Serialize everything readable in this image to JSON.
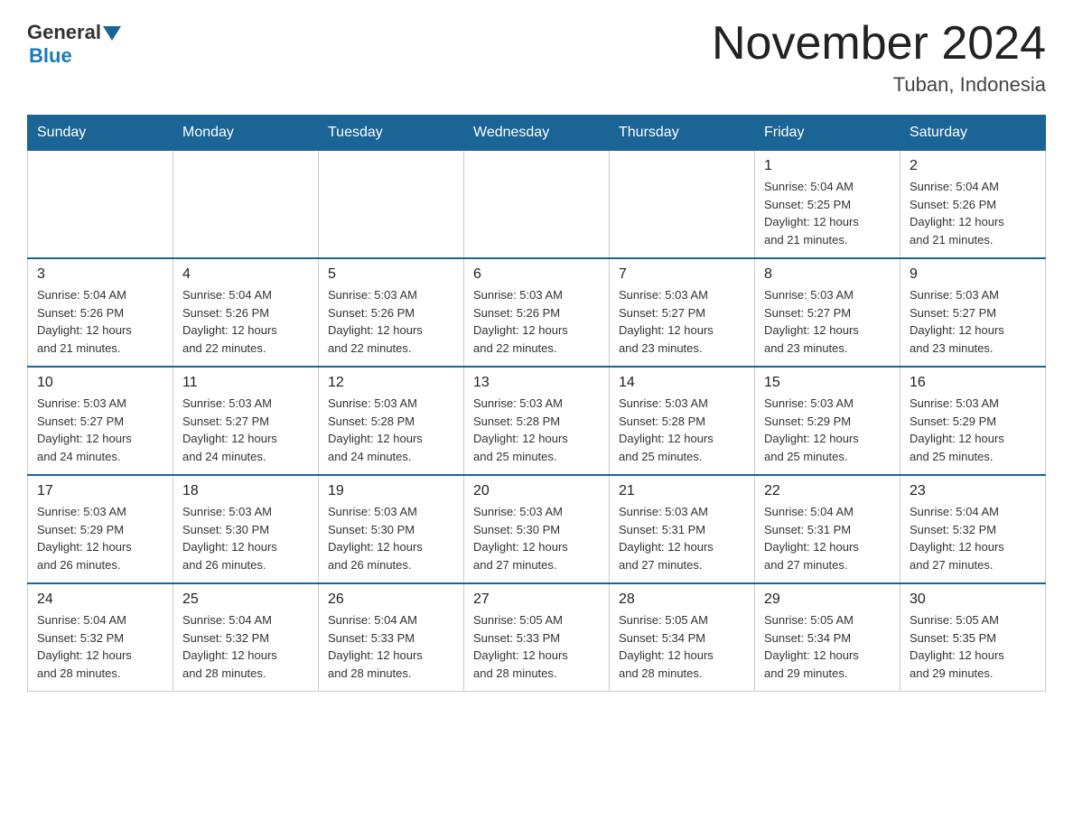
{
  "header": {
    "logo_text_general": "General",
    "logo_text_blue": "Blue",
    "month_title": "November 2024",
    "location": "Tuban, Indonesia"
  },
  "weekdays": [
    "Sunday",
    "Monday",
    "Tuesday",
    "Wednesday",
    "Thursday",
    "Friday",
    "Saturday"
  ],
  "weeks": [
    [
      {
        "day": "",
        "info": ""
      },
      {
        "day": "",
        "info": ""
      },
      {
        "day": "",
        "info": ""
      },
      {
        "day": "",
        "info": ""
      },
      {
        "day": "",
        "info": ""
      },
      {
        "day": "1",
        "info": "Sunrise: 5:04 AM\nSunset: 5:25 PM\nDaylight: 12 hours\nand 21 minutes."
      },
      {
        "day": "2",
        "info": "Sunrise: 5:04 AM\nSunset: 5:26 PM\nDaylight: 12 hours\nand 21 minutes."
      }
    ],
    [
      {
        "day": "3",
        "info": "Sunrise: 5:04 AM\nSunset: 5:26 PM\nDaylight: 12 hours\nand 21 minutes."
      },
      {
        "day": "4",
        "info": "Sunrise: 5:04 AM\nSunset: 5:26 PM\nDaylight: 12 hours\nand 22 minutes."
      },
      {
        "day": "5",
        "info": "Sunrise: 5:03 AM\nSunset: 5:26 PM\nDaylight: 12 hours\nand 22 minutes."
      },
      {
        "day": "6",
        "info": "Sunrise: 5:03 AM\nSunset: 5:26 PM\nDaylight: 12 hours\nand 22 minutes."
      },
      {
        "day": "7",
        "info": "Sunrise: 5:03 AM\nSunset: 5:27 PM\nDaylight: 12 hours\nand 23 minutes."
      },
      {
        "day": "8",
        "info": "Sunrise: 5:03 AM\nSunset: 5:27 PM\nDaylight: 12 hours\nand 23 minutes."
      },
      {
        "day": "9",
        "info": "Sunrise: 5:03 AM\nSunset: 5:27 PM\nDaylight: 12 hours\nand 23 minutes."
      }
    ],
    [
      {
        "day": "10",
        "info": "Sunrise: 5:03 AM\nSunset: 5:27 PM\nDaylight: 12 hours\nand 24 minutes."
      },
      {
        "day": "11",
        "info": "Sunrise: 5:03 AM\nSunset: 5:27 PM\nDaylight: 12 hours\nand 24 minutes."
      },
      {
        "day": "12",
        "info": "Sunrise: 5:03 AM\nSunset: 5:28 PM\nDaylight: 12 hours\nand 24 minutes."
      },
      {
        "day": "13",
        "info": "Sunrise: 5:03 AM\nSunset: 5:28 PM\nDaylight: 12 hours\nand 25 minutes."
      },
      {
        "day": "14",
        "info": "Sunrise: 5:03 AM\nSunset: 5:28 PM\nDaylight: 12 hours\nand 25 minutes."
      },
      {
        "day": "15",
        "info": "Sunrise: 5:03 AM\nSunset: 5:29 PM\nDaylight: 12 hours\nand 25 minutes."
      },
      {
        "day": "16",
        "info": "Sunrise: 5:03 AM\nSunset: 5:29 PM\nDaylight: 12 hours\nand 25 minutes."
      }
    ],
    [
      {
        "day": "17",
        "info": "Sunrise: 5:03 AM\nSunset: 5:29 PM\nDaylight: 12 hours\nand 26 minutes."
      },
      {
        "day": "18",
        "info": "Sunrise: 5:03 AM\nSunset: 5:30 PM\nDaylight: 12 hours\nand 26 minutes."
      },
      {
        "day": "19",
        "info": "Sunrise: 5:03 AM\nSunset: 5:30 PM\nDaylight: 12 hours\nand 26 minutes."
      },
      {
        "day": "20",
        "info": "Sunrise: 5:03 AM\nSunset: 5:30 PM\nDaylight: 12 hours\nand 27 minutes."
      },
      {
        "day": "21",
        "info": "Sunrise: 5:03 AM\nSunset: 5:31 PM\nDaylight: 12 hours\nand 27 minutes."
      },
      {
        "day": "22",
        "info": "Sunrise: 5:04 AM\nSunset: 5:31 PM\nDaylight: 12 hours\nand 27 minutes."
      },
      {
        "day": "23",
        "info": "Sunrise: 5:04 AM\nSunset: 5:32 PM\nDaylight: 12 hours\nand 27 minutes."
      }
    ],
    [
      {
        "day": "24",
        "info": "Sunrise: 5:04 AM\nSunset: 5:32 PM\nDaylight: 12 hours\nand 28 minutes."
      },
      {
        "day": "25",
        "info": "Sunrise: 5:04 AM\nSunset: 5:32 PM\nDaylight: 12 hours\nand 28 minutes."
      },
      {
        "day": "26",
        "info": "Sunrise: 5:04 AM\nSunset: 5:33 PM\nDaylight: 12 hours\nand 28 minutes."
      },
      {
        "day": "27",
        "info": "Sunrise: 5:05 AM\nSunset: 5:33 PM\nDaylight: 12 hours\nand 28 minutes."
      },
      {
        "day": "28",
        "info": "Sunrise: 5:05 AM\nSunset: 5:34 PM\nDaylight: 12 hours\nand 28 minutes."
      },
      {
        "day": "29",
        "info": "Sunrise: 5:05 AM\nSunset: 5:34 PM\nDaylight: 12 hours\nand 29 minutes."
      },
      {
        "day": "30",
        "info": "Sunrise: 5:05 AM\nSunset: 5:35 PM\nDaylight: 12 hours\nand 29 minutes."
      }
    ]
  ]
}
